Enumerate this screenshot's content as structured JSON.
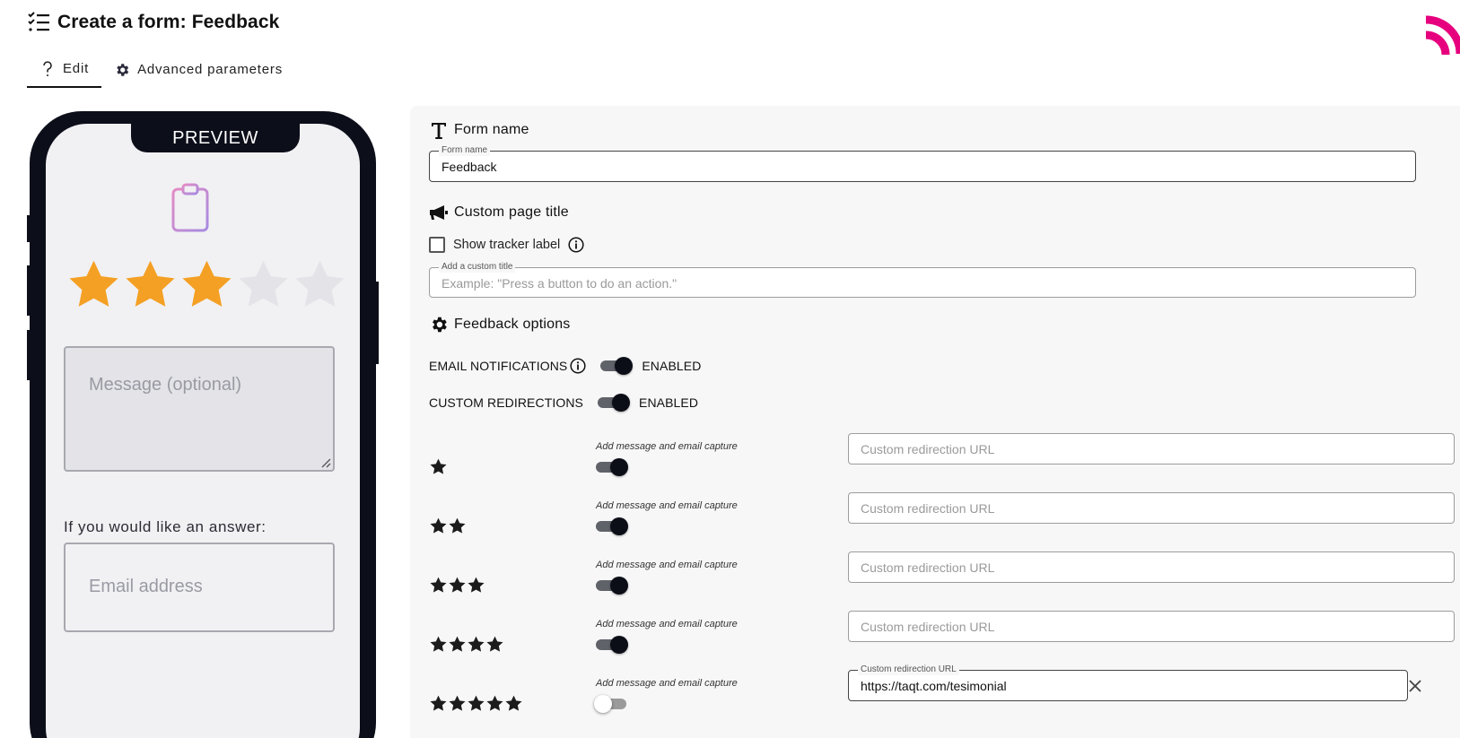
{
  "header": {
    "title": "Create a form: Feedback",
    "list_icon": "checklist-icon",
    "brand_color": "#e6007e"
  },
  "tabs": [
    {
      "label": "Edit",
      "icon": "question-mark-icon",
      "active": true
    },
    {
      "label": "Advanced parameters",
      "icon": "gear-icon",
      "active": false
    }
  ],
  "preview": {
    "label": "PREVIEW",
    "rating_filled": 3,
    "rating_total": 5,
    "star_color": "#f4a024",
    "message_placeholder": "Message (optional)",
    "answer_label": "If you would like an answer:",
    "email_placeholder": "Email address"
  },
  "form": {
    "form_name_section": "Form name",
    "form_name_legend": "Form name",
    "form_name_value": "Feedback",
    "page_title_section": "Custom page title",
    "tracker_label": "Show tracker label",
    "custom_title_legend": "Add a custom title",
    "custom_title_placeholder": "Example: \"Press a button to do an action.\"",
    "feedback_section": "Feedback options",
    "email_notifications_label": "EMAIL NOTIFICATIONS",
    "email_notifications_state": "ENABLED",
    "custom_redirections_label": "CUSTOM REDIRECTIONS",
    "custom_redirections_state": "ENABLED"
  },
  "ratings": [
    {
      "stars": 1,
      "capture_label": "Add message and email capture",
      "capture_on": true,
      "url_placeholder": "Custom redirection URL",
      "url_value": ""
    },
    {
      "stars": 2,
      "capture_label": "Add message and email capture",
      "capture_on": true,
      "url_placeholder": "Custom redirection URL",
      "url_value": ""
    },
    {
      "stars": 3,
      "capture_label": "Add message and email capture",
      "capture_on": true,
      "url_placeholder": "Custom redirection URL",
      "url_value": ""
    },
    {
      "stars": 4,
      "capture_label": "Add message and email capture",
      "capture_on": true,
      "url_placeholder": "Custom redirection URL",
      "url_value": ""
    },
    {
      "stars": 5,
      "capture_label": "Add message and email capture",
      "capture_on": false,
      "url_legend": "Custom redirection URL",
      "url_value": "https://taqt.com/tesimonial"
    }
  ]
}
